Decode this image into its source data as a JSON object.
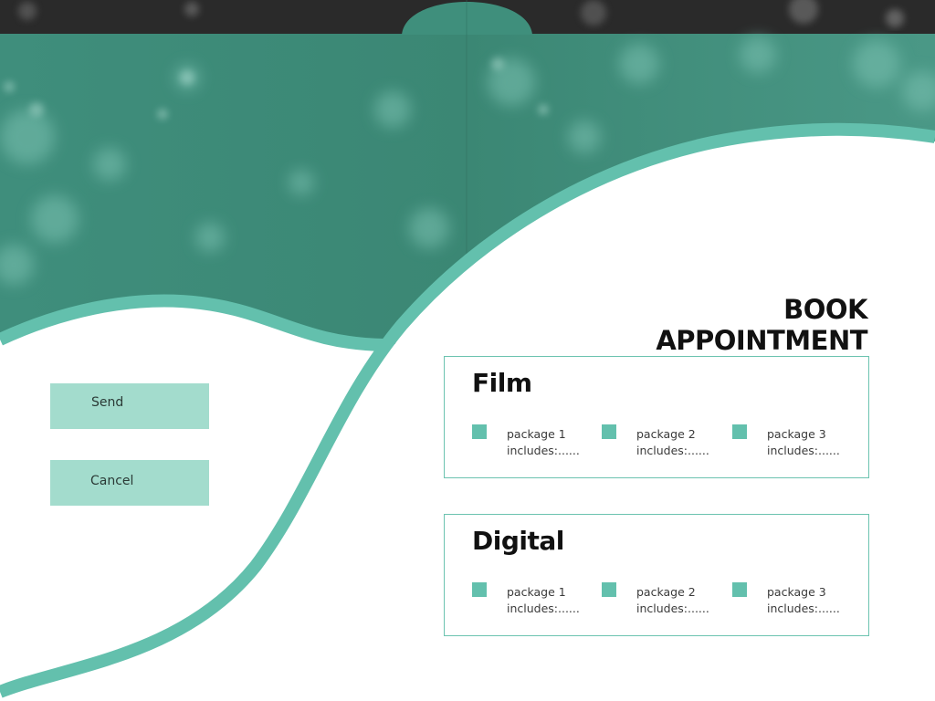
{
  "page": {
    "title": "BOOK APPOINTMENT"
  },
  "buttons": {
    "send": "Send",
    "cancel": "Cancel"
  },
  "sections": [
    {
      "title": "Film",
      "packages": [
        {
          "name": "package 1",
          "desc": "includes:......"
        },
        {
          "name": "package 2",
          "desc": "includes:......"
        },
        {
          "name": "package 3",
          "desc": "includes:......"
        }
      ]
    },
    {
      "title": "Digital",
      "packages": [
        {
          "name": "package 1",
          "desc": "includes:......"
        },
        {
          "name": "package 2",
          "desc": "includes:......"
        },
        {
          "name": "package 3",
          "desc": "includes:......"
        }
      ]
    }
  ],
  "colors": {
    "teal_dark": "#3e8a78",
    "teal_accent": "#63c0ad",
    "button_bg": "#a3dccd",
    "top_dark": "#222222"
  }
}
